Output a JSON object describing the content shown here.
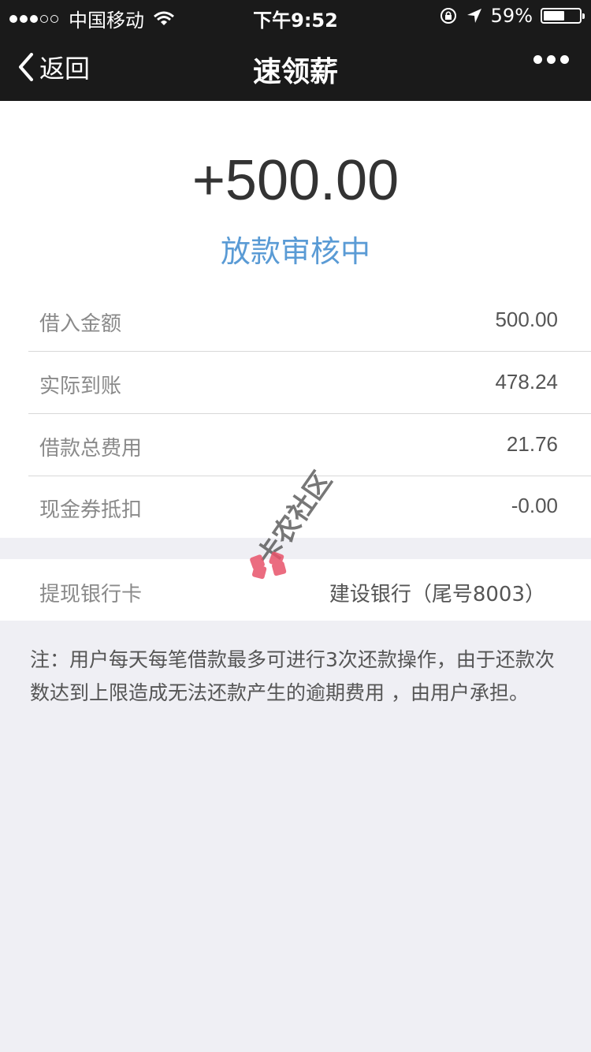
{
  "status_bar": {
    "carrier": "中国移动",
    "time": "下午9:52",
    "battery_text": "59%",
    "battery_level": 0.59
  },
  "nav": {
    "back_label": "返回",
    "title": "速领薪"
  },
  "hero": {
    "amount": "+500.00",
    "status": "放款审核中"
  },
  "details": [
    {
      "label": "借入金额",
      "value": "500.00"
    },
    {
      "label": "实际到账",
      "value": "478.24"
    },
    {
      "label": "借款总费用",
      "value": "21.76"
    },
    {
      "label": "现金券抵扣",
      "value": "-0.00"
    }
  ],
  "bank": {
    "label": "提现银行卡",
    "value": "建设银行（尾号8003）"
  },
  "note": "注：用户每天每笔借款最多可进行3次还款操作，由于还款次数达到上限造成无法还款产生的逾期费用 ，由用户承担。",
  "watermark": {
    "text": "卡农社区"
  },
  "colors": {
    "nav_bg": "#1a1a1a",
    "status_blue": "#5a9bd5",
    "page_bg": "#efeff4",
    "watermark_red": "#e8536a"
  },
  "icons": [
    "signal-dots-icon",
    "wifi-icon",
    "orientation-lock-icon",
    "location-arrow-icon",
    "battery-icon",
    "chevron-left-icon",
    "more-dots-icon"
  ]
}
